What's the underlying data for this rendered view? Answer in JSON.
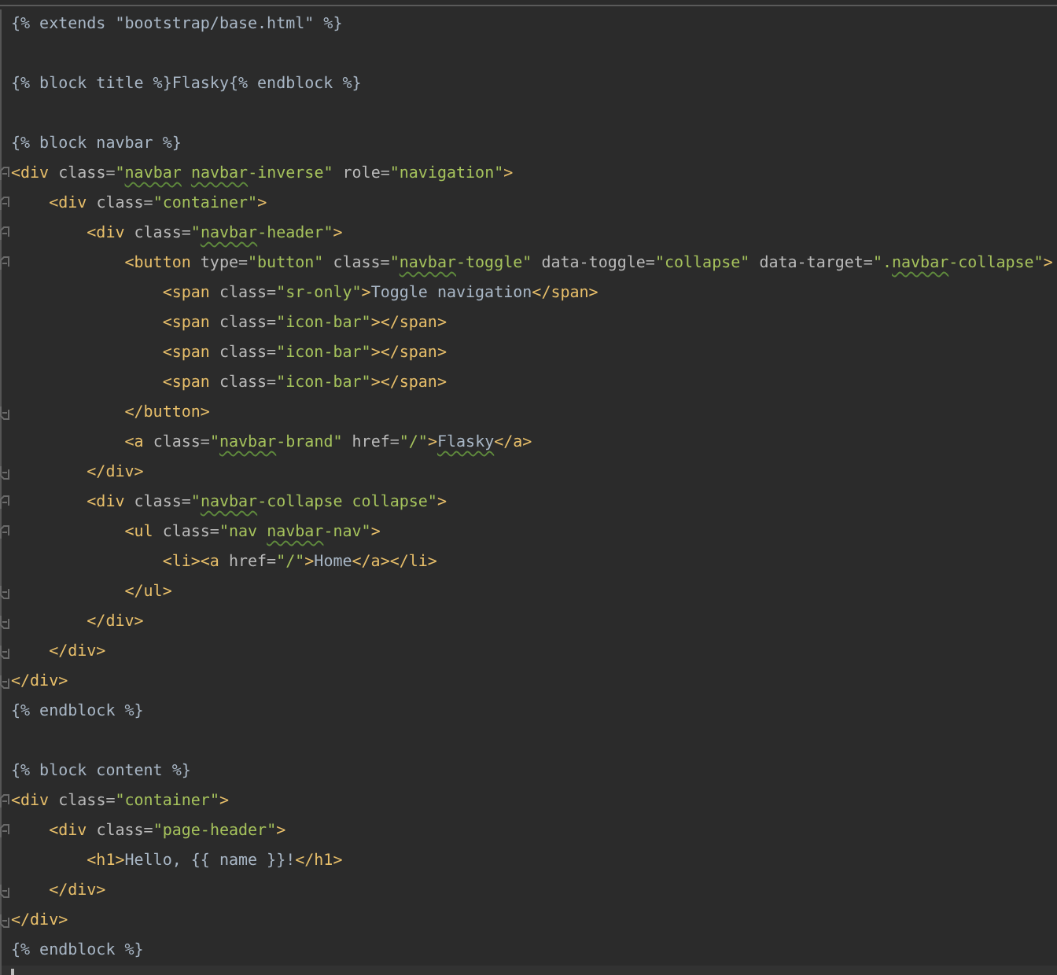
{
  "editor": {
    "lines": [
      {
        "current": false,
        "segments": [
          {
            "kind": "text",
            "text": "{% extends \"bootstrap/base.html\" %}"
          }
        ]
      },
      {
        "current": false
      },
      {
        "current": false,
        "segments": [
          {
            "kind": "text",
            "text": "{% block title %}Flasky{% endblock %}"
          }
        ]
      },
      {
        "current": false
      },
      {
        "current": false,
        "segments": [
          {
            "kind": "text",
            "text": "{% block navbar %}"
          }
        ]
      },
      {
        "current": false,
        "fold_open": true,
        "segments": [
          {
            "kind": "tag",
            "text": "<div"
          },
          {
            "kind": "attr",
            "text": " class="
          },
          {
            "kind": "string",
            "text": "\""
          },
          {
            "kind": "string",
            "text": "navbar",
            "typo": true
          },
          {
            "kind": "string",
            "text": " navbar",
            "typo": true
          },
          {
            "kind": "string",
            "text": "-inverse\""
          },
          {
            "kind": "attr",
            "text": " role="
          },
          {
            "kind": "string",
            "text": "\"navigation\""
          },
          {
            "kind": "tag",
            "text": ">"
          }
        ]
      },
      {
        "current": false,
        "fold_open": true,
        "segments": [
          {
            "kind": "tag",
            "text": "    <div"
          },
          {
            "kind": "attr",
            "text": " class="
          },
          {
            "kind": "string",
            "text": "\"container\""
          },
          {
            "kind": "tag",
            "text": ">"
          }
        ]
      },
      {
        "current": false,
        "fold_open": true,
        "segments": [
          {
            "kind": "tag",
            "text": "        <div"
          },
          {
            "kind": "attr",
            "text": " class="
          },
          {
            "kind": "string",
            "text": "\""
          },
          {
            "kind": "string",
            "text": "navbar",
            "typo": true
          },
          {
            "kind": "string",
            "text": "-header\""
          },
          {
            "kind": "tag",
            "text": ">"
          }
        ]
      },
      {
        "current": false,
        "fold_open": true,
        "segments": [
          {
            "kind": "tag",
            "text": "            <button"
          },
          {
            "kind": "attr",
            "text": " type="
          },
          {
            "kind": "string",
            "text": "\"button\""
          },
          {
            "kind": "attr",
            "text": " class="
          },
          {
            "kind": "string",
            "text": "\""
          },
          {
            "kind": "string",
            "text": "navbar",
            "typo": true
          },
          {
            "kind": "string",
            "text": "-toggle\""
          },
          {
            "kind": "attr",
            "text": " data-toggle="
          },
          {
            "kind": "string",
            "text": "\"collapse\""
          },
          {
            "kind": "attr",
            "text": " data-target="
          },
          {
            "kind": "string",
            "text": "\"."
          },
          {
            "kind": "string",
            "text": "navbar",
            "typo": true
          },
          {
            "kind": "string",
            "text": "-collapse\""
          },
          {
            "kind": "tag",
            "text": ">"
          }
        ]
      },
      {
        "current": false,
        "segments": [
          {
            "kind": "tag",
            "text": "                <span"
          },
          {
            "kind": "attr",
            "text": " class="
          },
          {
            "kind": "string",
            "text": "\"sr-only\""
          },
          {
            "kind": "tag",
            "text": ">"
          },
          {
            "kind": "text",
            "text": "Toggle navigation"
          },
          {
            "kind": "tag",
            "text": "</span>"
          }
        ]
      },
      {
        "current": false,
        "segments": [
          {
            "kind": "tag",
            "text": "                <span"
          },
          {
            "kind": "attr",
            "text": " class="
          },
          {
            "kind": "string",
            "text": "\"icon-bar\""
          },
          {
            "kind": "tag",
            "text": "></span>"
          }
        ]
      },
      {
        "current": false,
        "segments": [
          {
            "kind": "tag",
            "text": "                <span"
          },
          {
            "kind": "attr",
            "text": " class="
          },
          {
            "kind": "string",
            "text": "\"icon-bar\""
          },
          {
            "kind": "tag",
            "text": "></span>"
          }
        ]
      },
      {
        "current": false,
        "segments": [
          {
            "kind": "tag",
            "text": "                <span"
          },
          {
            "kind": "attr",
            "text": " class="
          },
          {
            "kind": "string",
            "text": "\"icon-bar\""
          },
          {
            "kind": "tag",
            "text": "></span>"
          }
        ]
      },
      {
        "current": false,
        "fold_close": true,
        "segments": [
          {
            "kind": "tag",
            "text": "            </button>"
          }
        ]
      },
      {
        "current": false,
        "segments": [
          {
            "kind": "tag",
            "text": "            <a"
          },
          {
            "kind": "attr",
            "text": " class="
          },
          {
            "kind": "string",
            "text": "\""
          },
          {
            "kind": "string",
            "text": "navbar",
            "typo": true
          },
          {
            "kind": "string",
            "text": "-brand\""
          },
          {
            "kind": "attr",
            "text": " href="
          },
          {
            "kind": "string",
            "text": "\"/\""
          },
          {
            "kind": "tag",
            "text": ">"
          },
          {
            "kind": "text",
            "text": "Flasky",
            "typo": true
          },
          {
            "kind": "tag",
            "text": "</a>"
          }
        ]
      },
      {
        "current": false,
        "fold_close": true,
        "segments": [
          {
            "kind": "tag",
            "text": "        </div>"
          }
        ]
      },
      {
        "current": false,
        "fold_open": true,
        "segments": [
          {
            "kind": "tag",
            "text": "        <div"
          },
          {
            "kind": "attr",
            "text": " class="
          },
          {
            "kind": "string",
            "text": "\""
          },
          {
            "kind": "string",
            "text": "navbar",
            "typo": true
          },
          {
            "kind": "string",
            "text": "-collapse collapse\""
          },
          {
            "kind": "tag",
            "text": ">"
          }
        ]
      },
      {
        "current": false,
        "fold_open": true,
        "segments": [
          {
            "kind": "tag",
            "text": "            <ul"
          },
          {
            "kind": "attr",
            "text": " class="
          },
          {
            "kind": "string",
            "text": "\"nav "
          },
          {
            "kind": "string",
            "text": "navbar",
            "typo": true
          },
          {
            "kind": "string",
            "text": "-nav\""
          },
          {
            "kind": "tag",
            "text": ">"
          }
        ]
      },
      {
        "current": false,
        "segments": [
          {
            "kind": "tag",
            "text": "                <li><a"
          },
          {
            "kind": "attr",
            "text": " href="
          },
          {
            "kind": "string",
            "text": "\"/\""
          },
          {
            "kind": "tag",
            "text": ">"
          },
          {
            "kind": "text",
            "text": "Home"
          },
          {
            "kind": "tag",
            "text": "</a></li>"
          }
        ]
      },
      {
        "current": false,
        "fold_close": true,
        "segments": [
          {
            "kind": "tag",
            "text": "            </ul>"
          }
        ]
      },
      {
        "current": false,
        "fold_close": true,
        "segments": [
          {
            "kind": "tag",
            "text": "        </div>"
          }
        ]
      },
      {
        "current": false,
        "fold_close": true,
        "segments": [
          {
            "kind": "tag",
            "text": "    </div>"
          }
        ]
      },
      {
        "current": false,
        "fold_close": true,
        "segments": [
          {
            "kind": "tag",
            "text": "</div>"
          }
        ]
      },
      {
        "current": false,
        "segments": [
          {
            "kind": "text",
            "text": "{% endblock %}"
          }
        ]
      },
      {
        "current": false
      },
      {
        "current": false,
        "segments": [
          {
            "kind": "text",
            "text": "{% block content %}"
          }
        ]
      },
      {
        "current": false,
        "fold_open": true,
        "segments": [
          {
            "kind": "tag",
            "text": "<div"
          },
          {
            "kind": "attr",
            "text": " class="
          },
          {
            "kind": "string",
            "text": "\"container\""
          },
          {
            "kind": "tag",
            "text": ">"
          }
        ]
      },
      {
        "current": false,
        "fold_open": true,
        "segments": [
          {
            "kind": "tag",
            "text": "    <div"
          },
          {
            "kind": "attr",
            "text": " class="
          },
          {
            "kind": "string",
            "text": "\"page-header\""
          },
          {
            "kind": "tag",
            "text": ">"
          }
        ]
      },
      {
        "current": false,
        "segments": [
          {
            "kind": "tag",
            "text": "        <h1>"
          },
          {
            "kind": "text",
            "text": "Hello, {{ name }}!"
          },
          {
            "kind": "tag",
            "text": "</h1>"
          }
        ]
      },
      {
        "current": false,
        "fold_close": true,
        "segments": [
          {
            "kind": "tag",
            "text": "    </div>"
          }
        ]
      },
      {
        "current": false,
        "fold_close": true,
        "segments": [
          {
            "kind": "tag",
            "text": "</div>"
          }
        ]
      },
      {
        "current": false,
        "segments": [
          {
            "kind": "text",
            "text": "{% endblock %}"
          }
        ]
      },
      {
        "current": true
      }
    ]
  }
}
